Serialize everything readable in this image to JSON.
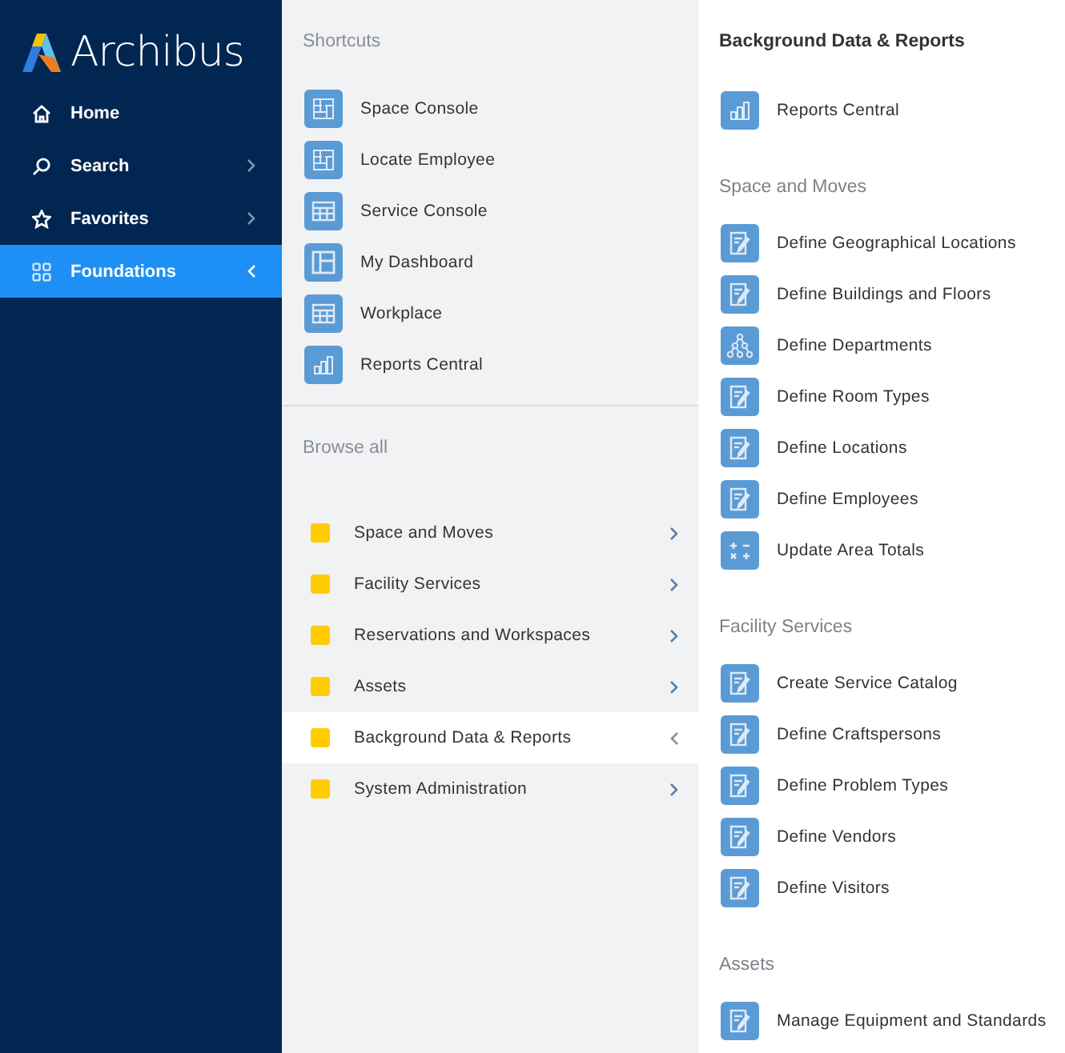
{
  "brand": {
    "name": "Archibus"
  },
  "nav": [
    {
      "label": "Home",
      "kind": "home",
      "expandable": false,
      "selected": false
    },
    {
      "label": "Search",
      "kind": "search",
      "expandable": true,
      "selected": false
    },
    {
      "label": "Favorites",
      "kind": "star",
      "expandable": true,
      "selected": false
    },
    {
      "label": "Foundations",
      "kind": "apps",
      "expandable": true,
      "selected": true
    }
  ],
  "shortcuts": {
    "title": "Shortcuts",
    "items": [
      {
        "label": "Space Console",
        "kind": "floorplan"
      },
      {
        "label": "Locate Employee",
        "kind": "floorplan"
      },
      {
        "label": "Service Console",
        "kind": "grid"
      },
      {
        "label": "My Dashboard",
        "kind": "dashboard"
      },
      {
        "label": "Workplace",
        "kind": "grid"
      },
      {
        "label": "Reports Central",
        "kind": "chart"
      }
    ]
  },
  "browse": {
    "title": "Browse all",
    "items": [
      {
        "label": "Space and Moves",
        "color": "#ffcc00",
        "selected": false
      },
      {
        "label": "Facility Services",
        "color": "#ffcc00",
        "selected": false
      },
      {
        "label": "Reservations and Workspaces",
        "color": "#ffcc00",
        "selected": false
      },
      {
        "label": "Assets",
        "color": "#ffcc00",
        "selected": false
      },
      {
        "label": "Background Data & Reports",
        "color": "#ffcc00",
        "selected": true
      },
      {
        "label": "System Administration",
        "color": "#ffcc00",
        "selected": false
      }
    ]
  },
  "detail": {
    "title": "Background Data & Reports",
    "groups": [
      {
        "items": [
          {
            "label": "Reports Central",
            "kind": "chart"
          }
        ]
      },
      {
        "title": "Space and Moves",
        "items": [
          {
            "label": "Define Geographical Locations",
            "kind": "edit"
          },
          {
            "label": "Define Buildings and Floors",
            "kind": "edit"
          },
          {
            "label": "Define Departments",
            "kind": "hierarchy"
          },
          {
            "label": "Define Room Types",
            "kind": "edit"
          },
          {
            "label": "Define Locations",
            "kind": "edit"
          },
          {
            "label": "Define Employees",
            "kind": "edit"
          },
          {
            "label": "Update Area Totals",
            "kind": "math"
          }
        ]
      },
      {
        "title": "Facility Services",
        "items": [
          {
            "label": "Create Service Catalog",
            "kind": "edit"
          },
          {
            "label": "Define Craftspersons",
            "kind": "edit"
          },
          {
            "label": "Define Problem Types",
            "kind": "edit"
          },
          {
            "label": "Define Vendors",
            "kind": "edit"
          },
          {
            "label": "Define Visitors",
            "kind": "edit"
          }
        ]
      },
      {
        "title": "Assets",
        "items": [
          {
            "label": "Manage Equipment and Standards",
            "kind": "edit"
          }
        ]
      }
    ]
  }
}
